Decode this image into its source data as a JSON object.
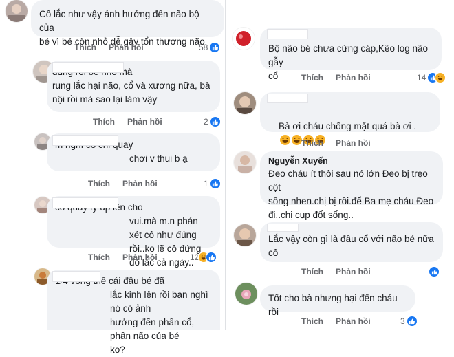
{
  "actions": {
    "like": "Thích",
    "reply": "Phản hồi"
  },
  "left_comments": [
    {
      "text": "Cô lắc như vậy ảnh hưởng đến não bộ của\nbé vì bé còn nhỏ dễ gây tổn thương não",
      "reaction_count": "58"
    },
    {
      "text": "đúng rồi bé nhỏ mà\nrung lắc hại não, cổ và xương nữa, bà\nnội rồi mà sao lại làm vậy",
      "reaction_count": "2"
    },
    {
      "text": "m nghĩ cô chỉ quay\nchơi v thui b ạ",
      "reaction_count": "1"
    },
    {
      "text": "cô quay tý úp lên cho\nvui.mà m.n phán xét cô như đúng\nrồi..ko lẽ cô đứng đó lắc cả ngày..",
      "reaction_count": "12"
    },
    {
      "text": "1/4 vòng thế cái đầu bé đã\nlắc kinh lên rồi bạn nghĩ nó có ảnh\nhưởng đến phần cổ, phần não của bé\nko?"
    }
  ],
  "right_comments": [
    {
      "text": "Bộ não bé chưa cứng cáp,Kẽo log não gẫy\ncổ",
      "reaction_count": "14"
    },
    {
      "text": "Bà ơi cháu chống mặt quá bà ơi ."
    },
    {
      "author": "Nguyễn Xuyến",
      "text": "Đeo cháu ít thôi sau nó lớn Đeo bị trẹo cột\nsống nhen.chị bị rồi.để Ba mẹ cháu Đeo\nđi..chị cụp đốt sống.."
    },
    {
      "text": "Lắc vậy còn gì là đầu cổ với não bé nữa\ncô"
    },
    {
      "text": "Tốt cho bà nhưng hại đến cháu rồi",
      "reaction_count": "3"
    }
  ],
  "colors": {
    "bubble": "#f0f2f5",
    "action_text": "#65676b",
    "like_blue": "#1877f2",
    "haha_yellow": "#f7b125"
  }
}
